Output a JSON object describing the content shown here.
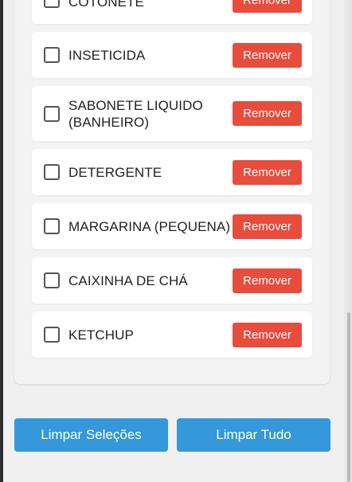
{
  "shopping_list": {
    "remove_label": "Remover",
    "items": [
      {
        "name": "COTONETE",
        "checked": false
      },
      {
        "name": "INSETICIDA",
        "checked": false
      },
      {
        "name": "SABONETE LIQUIDO (BANHEIRO)",
        "checked": false
      },
      {
        "name": "DETERGENTE",
        "checked": false
      },
      {
        "name": "MARGARINA (PEQUENA)",
        "checked": false
      },
      {
        "name": "CAIXINHA DE CHÁ",
        "checked": false
      },
      {
        "name": "KETCHUP",
        "checked": false
      }
    ]
  },
  "footer": {
    "clear_selections_label": "Limpar Seleções",
    "clear_all_label": "Limpar Tudo"
  },
  "colors": {
    "remove_button": "#e74c3c",
    "primary_button": "#3498db"
  }
}
